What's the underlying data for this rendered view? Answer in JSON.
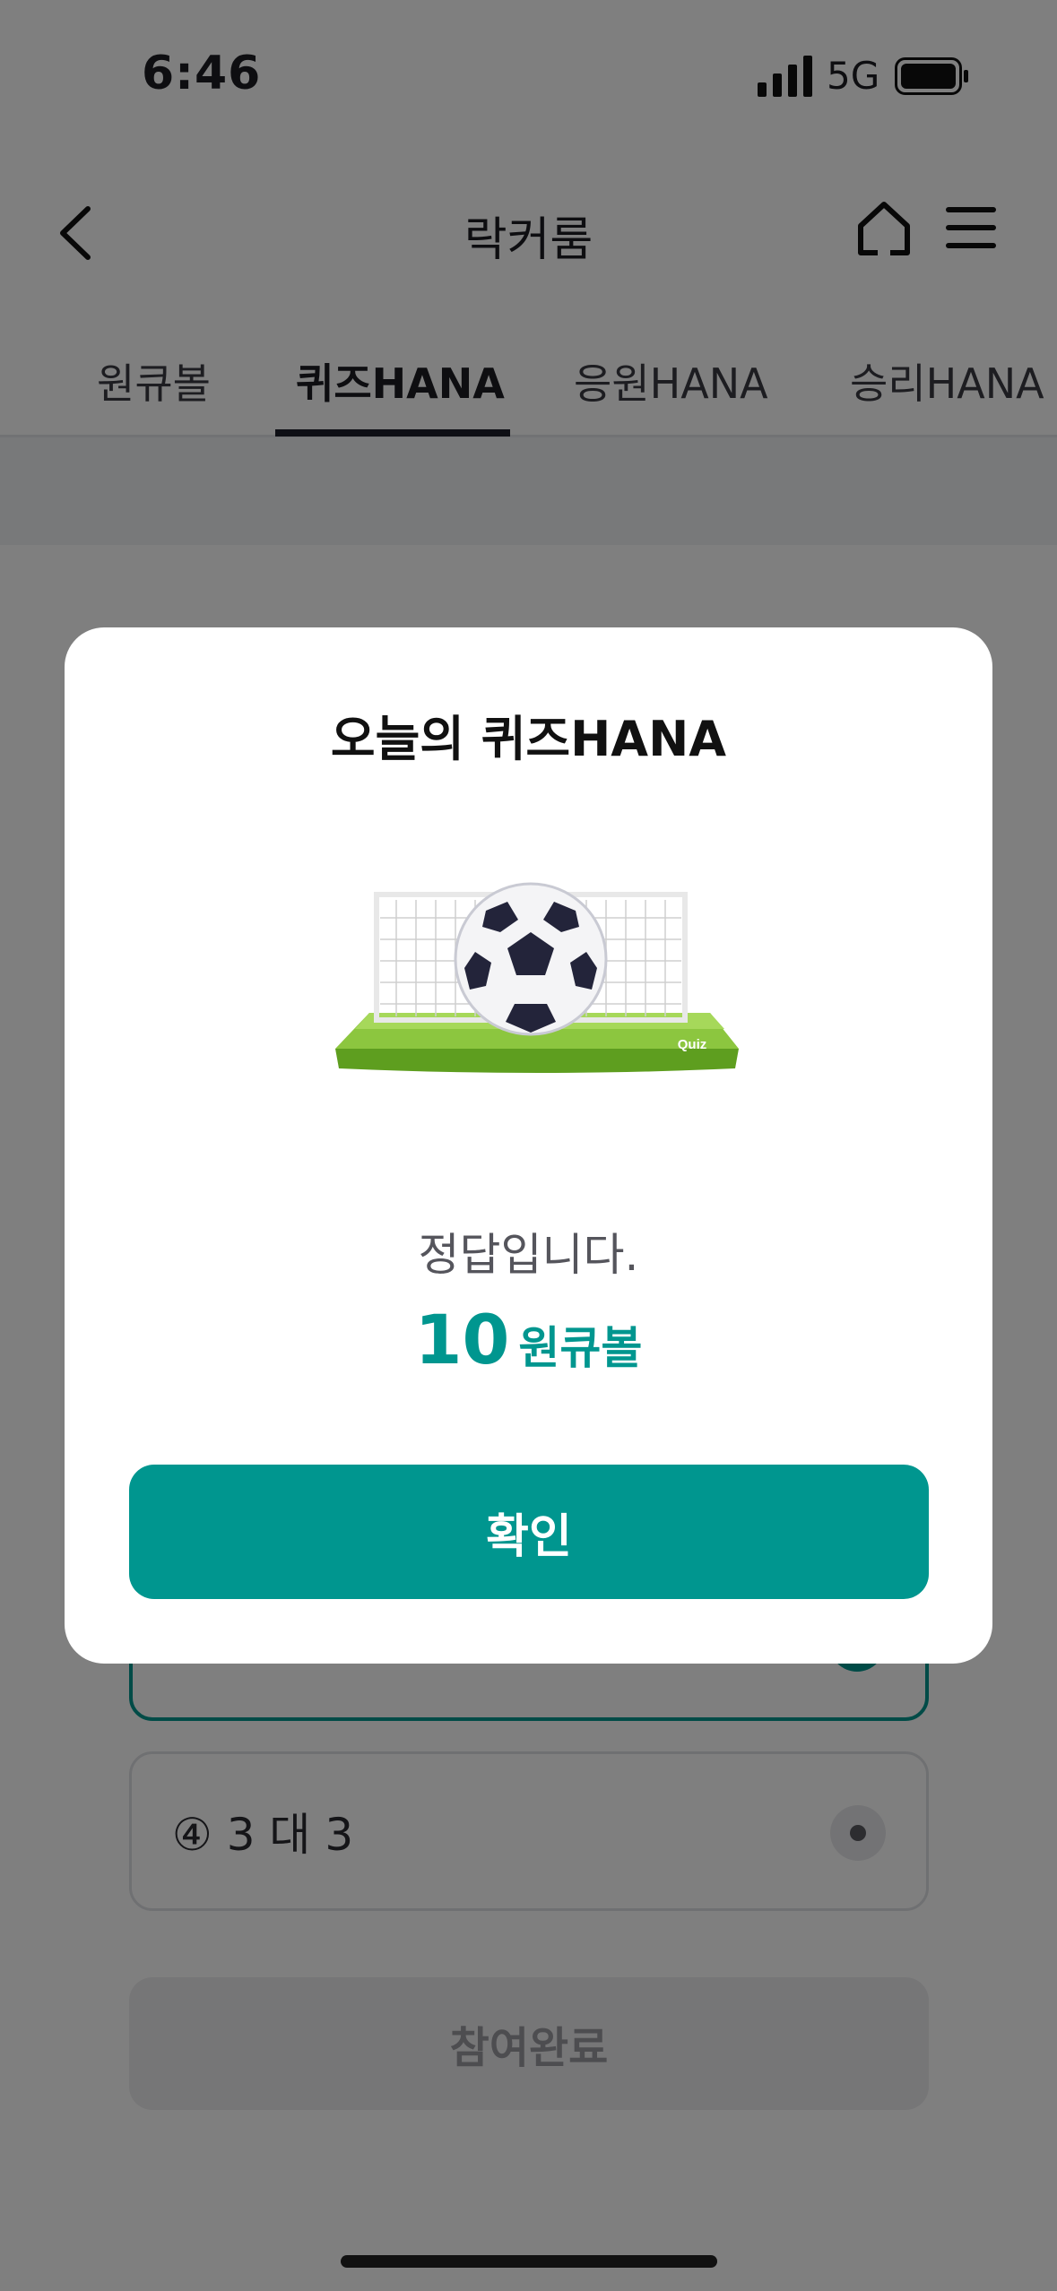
{
  "status_bar": {
    "time": "6:46",
    "network": "5G"
  },
  "nav": {
    "title": "락커룸"
  },
  "tabs": [
    {
      "label": "원큐볼"
    },
    {
      "label": "퀴즈HANA"
    },
    {
      "label": "응원HANA"
    },
    {
      "label": "승리HANA"
    }
  ],
  "background": {
    "options": [
      {
        "label": ""
      },
      {
        "label": "④ 3 대 3"
      }
    ],
    "done_button": "참여완료"
  },
  "modal": {
    "title": "오늘의 퀴즈HANA",
    "illustration_caption": "Quiz",
    "result": "정답입니다.",
    "reward_amount": "10",
    "reward_unit": "원큐볼",
    "confirm_button": "확인"
  },
  "colors": {
    "accent": "#00968f",
    "overlay": "rgba(0,0,0,0.5)"
  }
}
